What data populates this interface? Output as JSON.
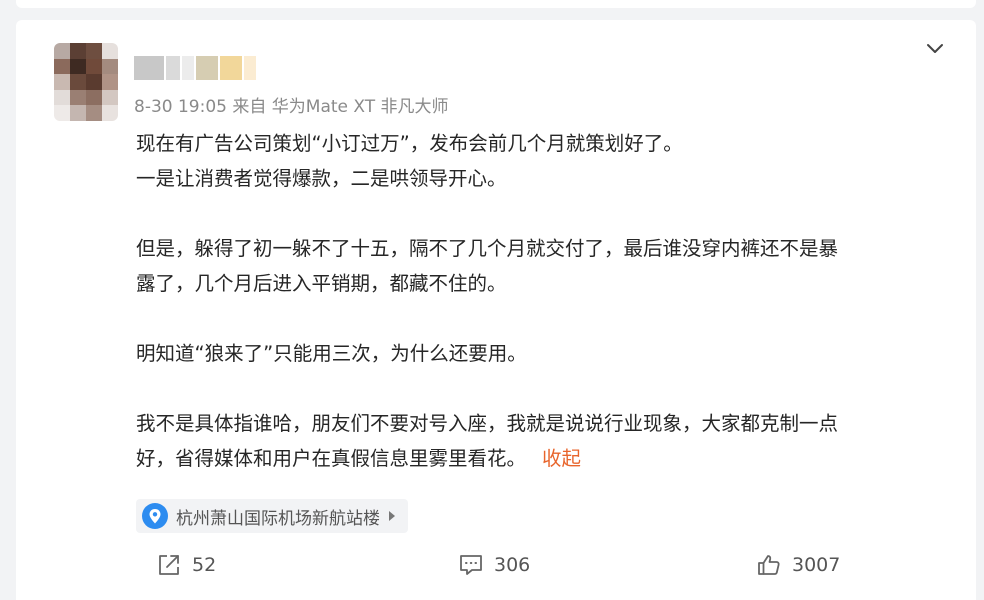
{
  "post": {
    "author": {
      "name_blurred": true,
      "avatar_blurred": true
    },
    "meta": "8-30 19:05  来自 华为Mate XT 非凡大师",
    "more_icon": "chevron-down-icon",
    "content": {
      "paragraphs": [
        [
          "现在有广告公司策划“小订过万”，发布会前几个月就策划好了。",
          "一是让消费者觉得爆款，二是哄领导开心。"
        ],
        [
          "但是，躲得了初一躲不了十五，隔不了几个月就交付了，最后谁没穿内裤还不是暴",
          "露了，几个月后进入平销期，都藏不住的。"
        ],
        [
          "明知道“狼来了”只能用三次，为什么还要用。"
        ],
        [
          "我不是具体指谁哈，朋友们不要对号入座，我就是说说行业现象，大家都克制一点",
          "好，省得媒体和用户在真假信息里雾里看花。"
        ]
      ],
      "collapse_label": "收起"
    },
    "location": {
      "label": "杭州萧山国际机场新航站楼",
      "icon": "location-pin-icon",
      "arrow_icon": "caret-right-icon"
    },
    "actions": {
      "repost": {
        "icon": "share-icon",
        "count": "52"
      },
      "comment": {
        "icon": "comment-icon",
        "count": "306"
      },
      "like": {
        "icon": "thumbs-up-icon",
        "count": "3007"
      }
    }
  },
  "colors": {
    "accent_link": "#e8652c",
    "location_pin": "#2d8cf0",
    "meta_text": "#8a8a8a",
    "body_text": "#262626"
  }
}
